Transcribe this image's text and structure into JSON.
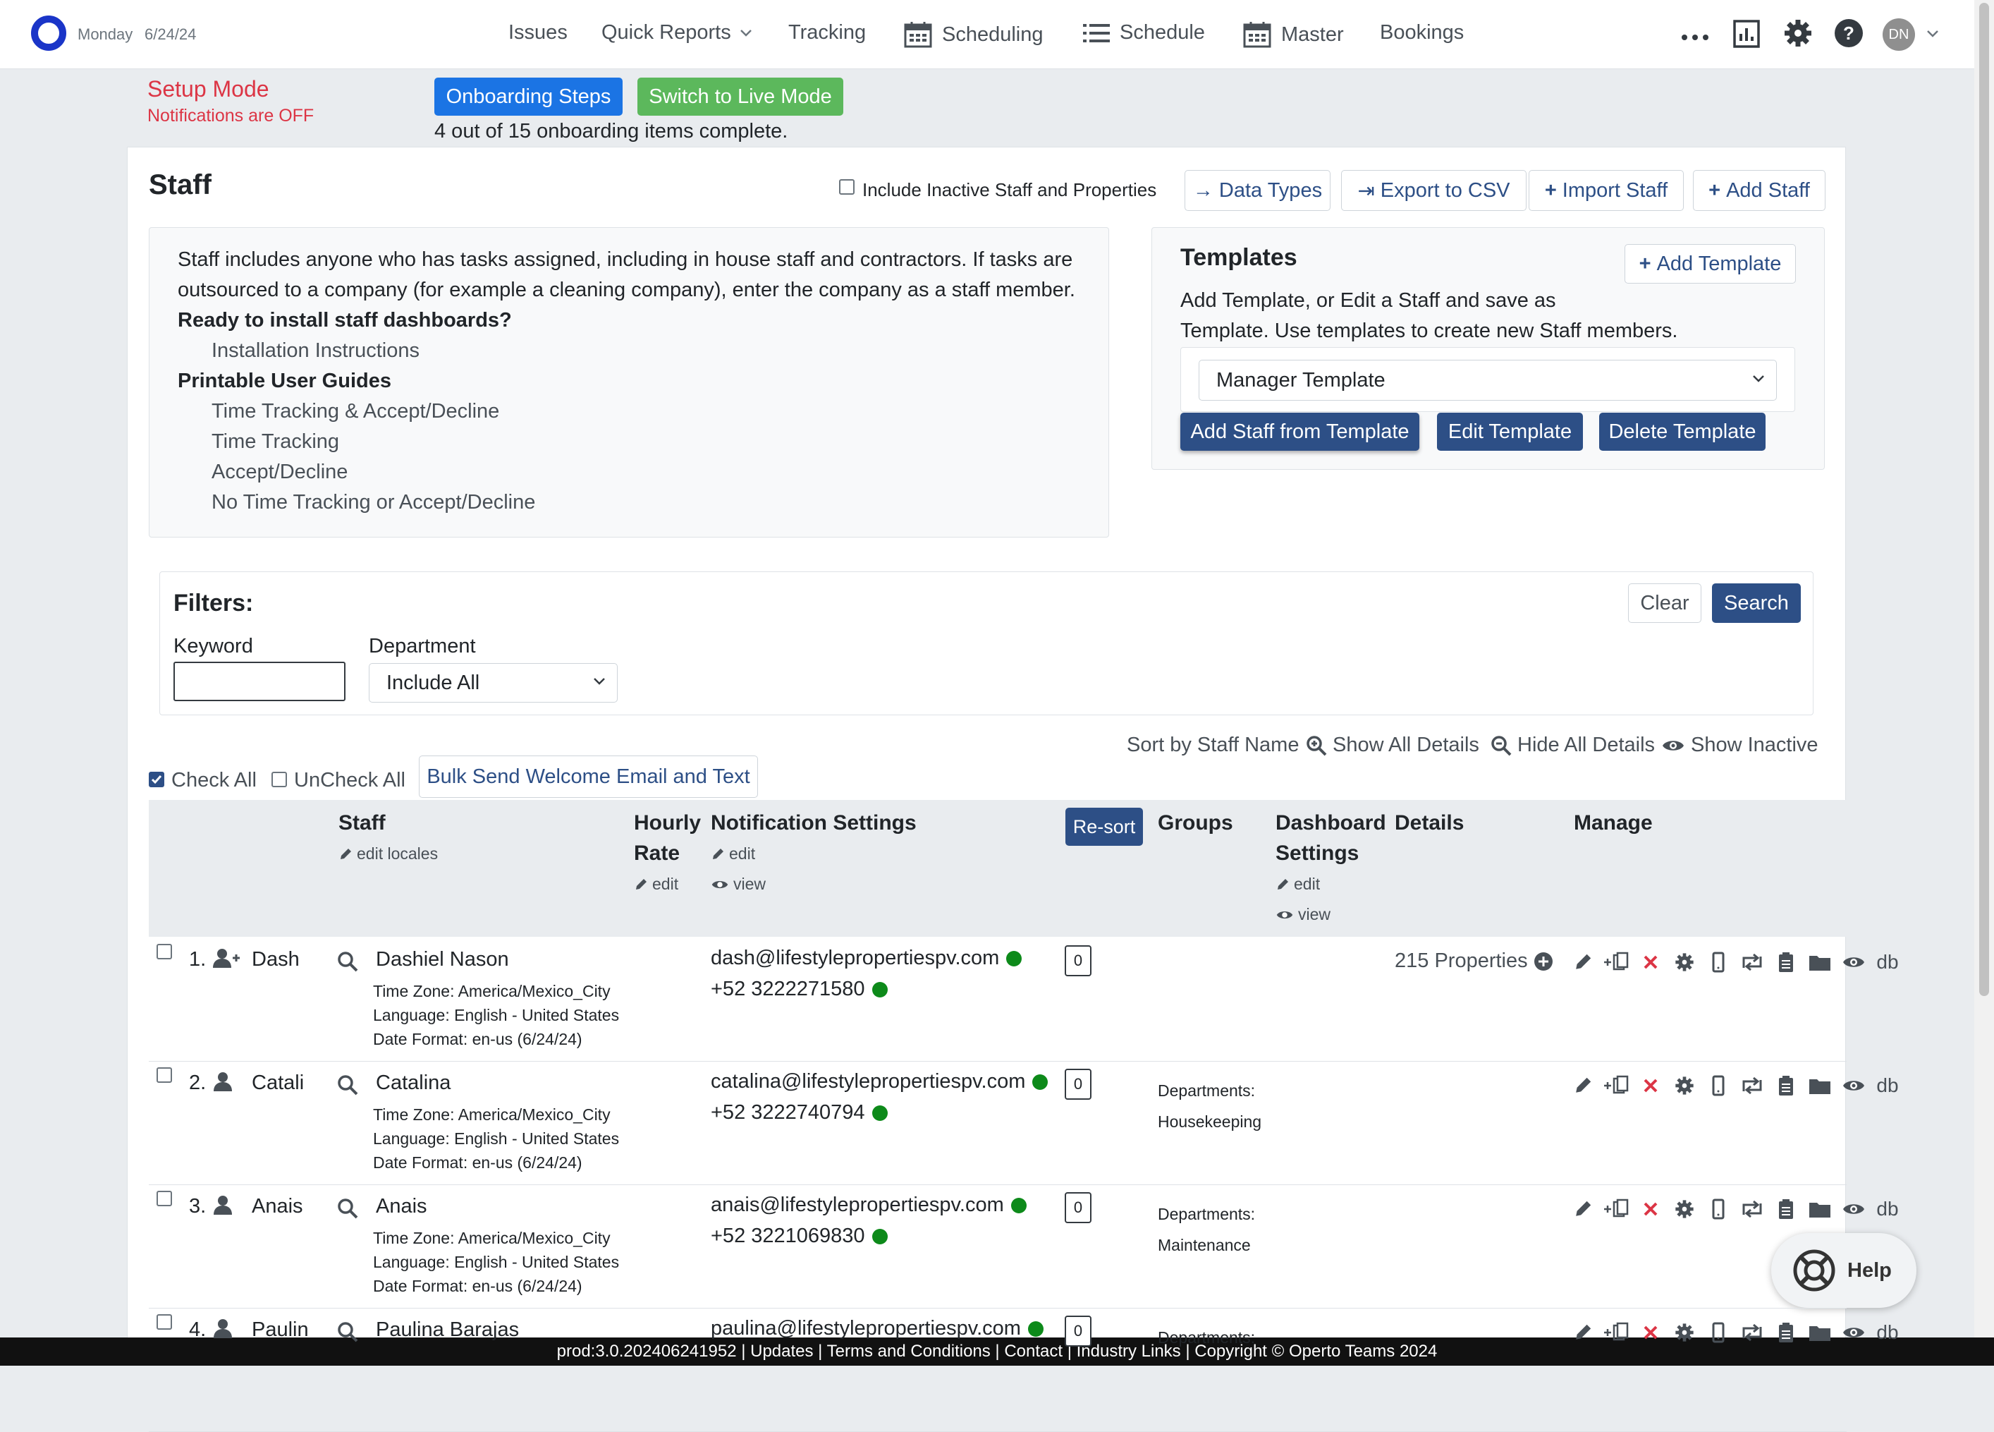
{
  "nav": {
    "day": "Monday",
    "date": "6/24/24",
    "items": [
      "Issues",
      "Quick Reports",
      "Tracking",
      "Scheduling",
      "Schedule",
      "Master",
      "Bookings"
    ],
    "more": "...",
    "user_initials": "DN"
  },
  "setup": {
    "title": "Setup Mode",
    "notifications": "Notifications are OFF",
    "onboarding_label": "Onboarding Steps",
    "live_label": "Switch to Live Mode",
    "progress_text": "4 out of 15 onboarding items complete."
  },
  "staff_page": {
    "title": "Staff",
    "include_inactive": "Include Inactive Staff and Properties",
    "actions": [
      "Data Types",
      "Export to CSV",
      "Import Staff",
      "Add Staff"
    ]
  },
  "info": {
    "line1": "Staff includes anyone who has tasks assigned, including in house staff and contractors. If tasks are",
    "line2": "outsourced to a company (for example a cleaning company), enter the company as a staff member.",
    "dash_heading": "Ready to install staff dashboards?",
    "install_link": "Installation Instructions",
    "guides_heading": "Printable User Guides",
    "guides": [
      "Time Tracking & Accept/Decline",
      "Time Tracking",
      "Accept/Decline",
      "No Time Tracking or Accept/Decline"
    ]
  },
  "templates": {
    "title": "Templates",
    "add_label": "Add Template",
    "desc1": "Add Template, or Edit a Staff and save as",
    "desc2": "Template. Use templates to create new Staff members.",
    "selected": "Manager Template",
    "buttons": [
      "Add Staff from Template",
      "Edit Template",
      "Delete Template"
    ]
  },
  "filters": {
    "title": "Filters:",
    "keyword_label": "Keyword",
    "keyword_value": "",
    "department_label": "Department",
    "department_value": "Include All",
    "clear_label": "Clear",
    "search_label": "Search"
  },
  "list_controls": {
    "sort": "Sort by Staff Name",
    "show_all": "Show All Details",
    "hide_all": "Hide All Details",
    "show_inactive": "Show Inactive",
    "check_all": "Check All",
    "uncheck_all": "UnCheck All",
    "bulk_send": "Bulk Send Welcome Email and Text"
  },
  "table": {
    "headers": {
      "staff": "Staff",
      "staff_edit": "edit locales",
      "hourly1": "Hourly",
      "hourly2": "Rate",
      "hourly_edit": "edit",
      "notif": "Notification Settings",
      "notif_edit": "edit",
      "notif_view": "view",
      "resort": "Re-sort",
      "groups": "Groups",
      "dash1": "Dashboard",
      "dash2": "Settings",
      "dash_edit": "edit",
      "dash_view": "view",
      "details": "Details",
      "manage": "Manage"
    },
    "rows": [
      {
        "num": "1.",
        "short": "Dash",
        "name": "Dashiel Nason",
        "tz": "Time Zone: America/Mexico_City",
        "lang": "Language: English - United States",
        "fmt": "Date Format: en-us (6/24/24)",
        "email": "dash@lifestylepropertiespv.com",
        "phone": "+52 3222271580",
        "order": "0",
        "dept_label": "",
        "dept": "",
        "details": "215 Properties",
        "db": "db"
      },
      {
        "num": "2.",
        "short": "Catali",
        "name": "Catalina",
        "tz": "Time Zone: America/Mexico_City",
        "lang": "Language: English - United States",
        "fmt": "Date Format: en-us (6/24/24)",
        "email": "catalina@lifestylepropertiespv.com",
        "phone": "+52 3222740794",
        "order": "0",
        "dept_label": "Departments:",
        "dept": "Housekeeping",
        "details": "",
        "db": "db"
      },
      {
        "num": "3.",
        "short": "Anais",
        "name": "Anais",
        "tz": "Time Zone: America/Mexico_City",
        "lang": "Language: English - United States",
        "fmt": "Date Format: en-us (6/24/24)",
        "email": "anais@lifestylepropertiespv.com",
        "phone": "+52 3221069830",
        "order": "0",
        "dept_label": "Departments:",
        "dept": "Maintenance",
        "details": "",
        "db": "db"
      },
      {
        "num": "4.",
        "short": "Paulin",
        "name": "Paulina Barajas",
        "tz": "",
        "lang": "",
        "fmt": "",
        "email": "paulina@lifestylepropertiespv.com",
        "phone": "",
        "order": "0",
        "dept_label": "Departments:",
        "dept": "",
        "details": "",
        "db": "db"
      }
    ]
  },
  "help_label": "Help",
  "footer": "prod:3.0.202406241952 | Updates | Terms and Conditions | Contact | Industry Links | Copyright © Operto Teams 2024"
}
